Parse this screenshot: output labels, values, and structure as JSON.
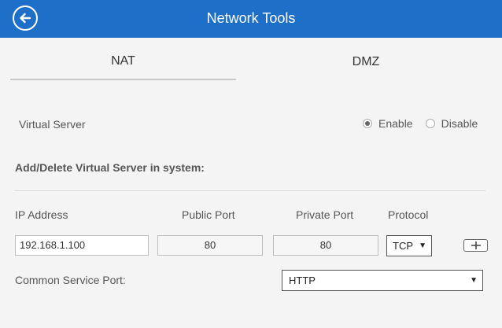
{
  "header": {
    "title": "Network Tools",
    "back_icon": "back-arrow-circle-icon",
    "color": "#1e6fc8"
  },
  "tabs": [
    {
      "label": "NAT",
      "active": true
    },
    {
      "label": "DMZ",
      "active": false
    }
  ],
  "virtual_server": {
    "label": "Virtual Server",
    "options": [
      {
        "label": "Enable",
        "checked": true
      },
      {
        "label": "Disable",
        "checked": false
      }
    ]
  },
  "section": {
    "title": "Add/Delete Virtual Server in system:"
  },
  "columns": {
    "ip": "IP Address",
    "public_port": "Public Port",
    "private_port": "Private Port",
    "protocol": "Protocol"
  },
  "entry": {
    "ip": "192.168.1.100",
    "public_port": "80",
    "private_port": "80",
    "protocol": "TCP"
  },
  "add_icon": "plus-icon",
  "common_service": {
    "label": "Common Service Port:",
    "value": "HTTP"
  }
}
